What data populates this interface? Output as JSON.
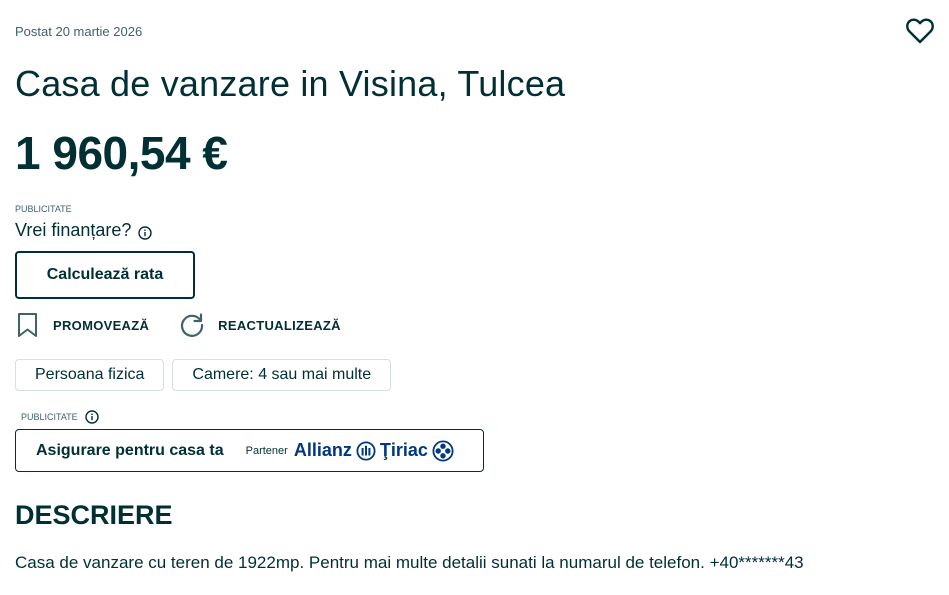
{
  "listing": {
    "posted": "Postat 20 martie 2026",
    "title": "Casa de vanzare in Visina, Tulcea",
    "price": "1 960,54 €"
  },
  "finance": {
    "ad_label": "PUBLICITATE",
    "question": "Vrei finanțare?",
    "calc_button": "Calculează rata"
  },
  "actions": {
    "promote": "PROMOVEAZĂ",
    "refresh": "REACTUALIZEAZĂ"
  },
  "tags": [
    "Persoana fizica",
    "Camere: 4 sau mai multe"
  ],
  "insurance": {
    "ad_label": "PUBLICITATE",
    "text": "Asigurare pentru casa ta",
    "partner": "Partener",
    "brand_allianz": "Allianz",
    "brand_tiriac": "Ţiriac"
  },
  "description": {
    "title": "DESCRIERE",
    "text": "Casa de vanzare cu teren de 1922mp. Pentru mai multe detalii sunati la numarul de telefon. +40*******43"
  },
  "colors": {
    "text": "#002f34",
    "muted": "#406367",
    "brand": "#003781",
    "border": "#d8dfe0"
  },
  "icons": [
    "heart-icon",
    "info-icon",
    "bookmark-icon",
    "refresh-icon",
    "allianz-eagle-icon",
    "tiriac-cross-icon"
  ]
}
